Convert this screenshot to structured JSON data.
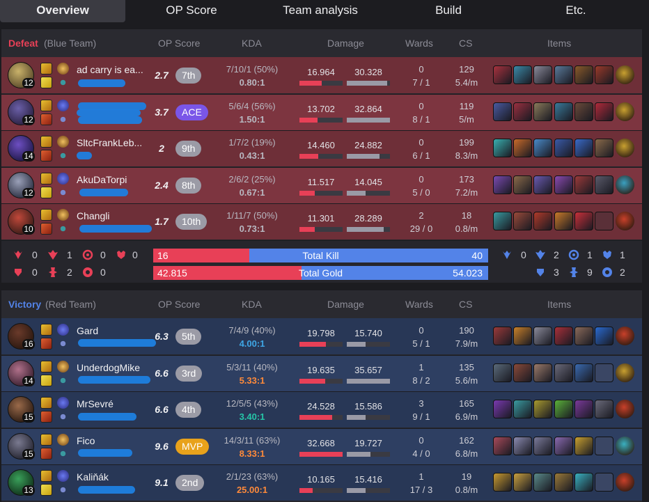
{
  "tabs": [
    "Overview",
    "OP Score",
    "Team analysis",
    "Build",
    "Etc."
  ],
  "headers": {
    "op_score": "OP Score",
    "kda": "KDA",
    "damage": "Damage",
    "wards": "Wards",
    "cs": "CS",
    "items": "Items"
  },
  "blue": {
    "result": "Defeat",
    "team": "(Blue Team)",
    "players": [
      {
        "name": "ad carry is ea...",
        "level": "12",
        "op": "2.7",
        "rank": "7th",
        "kda": "7/10/1 (50%)",
        "ratio": "0.80:1",
        "dealt": "16.964",
        "taken": "30.328",
        "dealt_frac": 0.52,
        "taken_frac": 0.93,
        "wards": "0",
        "wards2": "7 / 1",
        "cs": "129",
        "csm": "5.4/m"
      },
      {
        "name": "",
        "level": "12",
        "op": "3.7",
        "rank": "ACE",
        "kda": "5/6/4 (56%)",
        "ratio": "1.50:1",
        "dealt": "13.702",
        "taken": "32.864",
        "dealt_frac": 0.42,
        "taken_frac": 1.0,
        "wards": "0",
        "wards2": "8 / 1",
        "cs": "119",
        "csm": "5/m"
      },
      {
        "name": "SltcFrankLeb...",
        "level": "14",
        "op": "2",
        "rank": "9th",
        "kda": "1/7/2 (19%)",
        "ratio": "0.43:1",
        "dealt": "14.460",
        "taken": "24.882",
        "dealt_frac": 0.44,
        "taken_frac": 0.76,
        "wards": "0",
        "wards2": "6 / 1",
        "cs": "199",
        "csm": "8.3/m"
      },
      {
        "name": "AkuDaTorpi",
        "level": "12",
        "op": "2.4",
        "rank": "8th",
        "kda": "2/6/2 (25%)",
        "ratio": "0.67:1",
        "dealt": "11.517",
        "taken": "14.045",
        "dealt_frac": 0.35,
        "taken_frac": 0.43,
        "wards": "0",
        "wards2": "5 / 0",
        "cs": "173",
        "csm": "7.2/m"
      },
      {
        "name": "Changli",
        "level": "10",
        "op": "1.7",
        "rank": "10th",
        "kda": "1/11/7 (50%)",
        "ratio": "0.73:1",
        "dealt": "11.301",
        "taken": "28.289",
        "dealt_frac": 0.35,
        "taken_frac": 0.86,
        "wards": "2",
        "wards2": "29 / 0",
        "cs": "18",
        "csm": "0.8/m"
      }
    ],
    "objectives": {
      "baron": "0",
      "dragon": "1",
      "herald": "0",
      "grub": "0",
      "tower": "0",
      "inhib": "2",
      "atakhan": "0"
    }
  },
  "red": {
    "result": "Victory",
    "team": "(Red Team)",
    "players": [
      {
        "name": "Gard",
        "level": "16",
        "op": "6.3",
        "rank": "5th",
        "kda": "7/4/9 (40%)",
        "ratio": "4.00:1",
        "dealt": "19.798",
        "taken": "15.740",
        "dealt_frac": 0.61,
        "taken_frac": 0.44,
        "wards": "0",
        "wards2": "5 / 1",
        "cs": "190",
        "csm": "7.9/m"
      },
      {
        "name": "UnderdogMike",
        "level": "14",
        "op": "6.6",
        "rank": "3rd",
        "kda": "5/3/11 (40%)",
        "ratio": "5.33:1",
        "dealt": "19.635",
        "taken": "35.657",
        "dealt_frac": 0.6,
        "taken_frac": 1.0,
        "wards": "1",
        "wards2": "8 / 2",
        "cs": "135",
        "csm": "5.6/m"
      },
      {
        "name": "MrSevré",
        "level": "15",
        "op": "6.6",
        "rank": "4th",
        "kda": "12/5/5 (43%)",
        "ratio": "3.40:1",
        "dealt": "24.528",
        "taken": "15.586",
        "dealt_frac": 0.75,
        "taken_frac": 0.44,
        "wards": "3",
        "wards2": "9 / 1",
        "cs": "165",
        "csm": "6.9/m"
      },
      {
        "name": "Fico",
        "level": "15",
        "op": "9.6",
        "rank": "MVP",
        "kda": "14/3/11 (63%)",
        "ratio": "8.33:1",
        "dealt": "32.668",
        "taken": "19.727",
        "dealt_frac": 1.0,
        "taken_frac": 0.55,
        "wards": "0",
        "wards2": "4 / 0",
        "cs": "162",
        "csm": "6.8/m"
      },
      {
        "name": "Kaliňák",
        "level": "13",
        "op": "9.1",
        "rank": "2nd",
        "kda": "2/1/23 (63%)",
        "ratio": "25.00:1",
        "dealt": "10.165",
        "taken": "15.416",
        "dealt_frac": 0.31,
        "taken_frac": 0.43,
        "wards": "1",
        "wards2": "17 / 3",
        "cs": "19",
        "csm": "0.8/m"
      }
    ],
    "objectives": {
      "baron": "0",
      "dragon": "2",
      "herald": "1",
      "grub": "1",
      "tower": "3",
      "inhib": "9",
      "atakhan": "2"
    }
  },
  "totals": {
    "kill_label": "Total Kill",
    "blue_kill": "16",
    "red_kill": "40",
    "kill_frac": 0.286,
    "gold_label": "Total Gold",
    "blue_gold": "42.815",
    "red_gold": "54.023",
    "gold_frac": 0.442
  },
  "colors": {
    "blue_team": "#e84057",
    "red_team": "#5383e8",
    "ace": "#7a56e8",
    "mvp": "#e8a21b",
    "ratio_blue": "#3fa7e6",
    "ratio_orange": "#ff8a3a",
    "ratio_green": "#26c6a8"
  }
}
